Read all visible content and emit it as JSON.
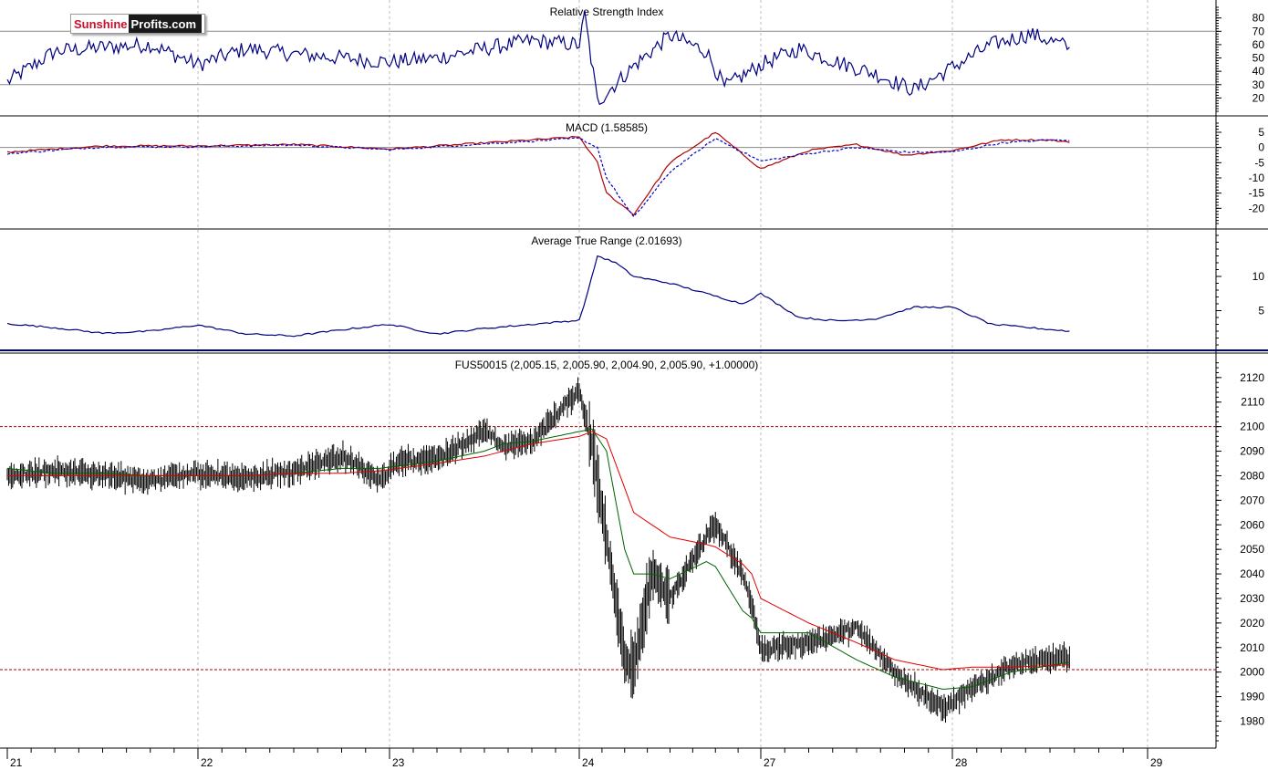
{
  "brand": {
    "part1": "Sunshine",
    "part2": "Profits.com"
  },
  "colors": {
    "price": "#000000",
    "sma_short": "#006400",
    "sma_long": "#e00000",
    "indicator": "#000080",
    "macd": "#b00000",
    "macd_signal": "#0000cc",
    "grid": "#bdbdbd",
    "hline": "#8a8a8a",
    "resistance": "#b00000"
  },
  "x_axis": {
    "ticks": [
      "21",
      "22",
      "23",
      "24",
      "27",
      "28",
      "29"
    ]
  },
  "chart_data": [
    {
      "type": "line",
      "title": "Relative Strength Index",
      "ylim": [
        10,
        88
      ],
      "y_ticks": [
        20,
        30,
        40,
        50,
        60,
        70,
        80
      ],
      "hlines": [
        30,
        70
      ],
      "grid": true,
      "x": [
        0,
        0.25,
        0.5,
        0.75,
        1.0,
        1.25,
        1.5,
        1.75,
        2.0,
        2.25,
        2.5,
        2.75,
        3.0,
        3.03,
        3.1,
        3.3,
        3.5,
        3.7,
        3.8,
        4.0,
        4.2,
        4.4,
        4.6,
        4.8,
        5.0,
        5.2,
        5.4,
        5.6
      ],
      "values": [
        32,
        55,
        58,
        60,
        45,
        57,
        53,
        50,
        47,
        50,
        57,
        63,
        60,
        82,
        17,
        44,
        67,
        55,
        28,
        45,
        57,
        47,
        38,
        26,
        43,
        60,
        68,
        58
      ]
    },
    {
      "type": "line",
      "title": "MACD (1.58585)",
      "ylim": [
        -25,
        8
      ],
      "y_ticks": [
        5,
        0,
        -5,
        -10,
        -15,
        -20
      ],
      "hlines": [
        0
      ],
      "grid": true,
      "x": [
        0,
        0.5,
        1.0,
        1.5,
        2.0,
        2.5,
        3.0,
        3.1,
        3.15,
        3.3,
        3.5,
        3.75,
        4.0,
        4.25,
        4.5,
        4.75,
        5.0,
        5.25,
        5.5,
        5.6
      ],
      "series": [
        {
          "values": [
            -1.5,
            0.5,
            0.5,
            1.0,
            -0.5,
            1.5,
            3.5,
            -5,
            -15,
            -22,
            -5,
            5,
            -7,
            -1,
            1,
            -2.5,
            -1,
            2.5,
            2.5,
            1.6
          ]
        },
        {
          "values": [
            -2.0,
            0.2,
            0.3,
            0.8,
            -0.7,
            1.2,
            3.0,
            0,
            -10,
            -23,
            -8,
            3,
            -4.5,
            -2,
            0,
            -1.5,
            -1.5,
            1.5,
            2.5,
            2.2
          ]
        }
      ]
    },
    {
      "type": "line",
      "title": "Average True Range (2.01693)",
      "ylim": [
        0,
        16
      ],
      "y_ticks": [
        10,
        5
      ],
      "grid": true,
      "x": [
        0,
        0.25,
        0.5,
        0.75,
        1.0,
        1.25,
        1.5,
        1.75,
        2.0,
        2.25,
        2.5,
        2.75,
        3.0,
        3.05,
        3.1,
        3.2,
        3.3,
        3.5,
        3.7,
        3.9,
        4.0,
        4.2,
        4.4,
        4.6,
        4.8,
        5.0,
        5.2,
        5.4,
        5.6
      ],
      "values": [
        3.1,
        2.5,
        1.7,
        2.0,
        2.9,
        1.6,
        1.3,
        2.2,
        3.0,
        1.6,
        2.4,
        3.0,
        3.6,
        8.0,
        13.0,
        12.0,
        10.0,
        9.0,
        7.5,
        6.0,
        7.5,
        4.0,
        3.5,
        3.8,
        5.5,
        5.5,
        3.0,
        2.5,
        2.0
      ]
    },
    {
      "type": "line",
      "title": "FUS50015 (2,005.15, 2,005.90, 2,004.90, 2,005.90, +1.00000)",
      "ylim": [
        1972,
        2127
      ],
      "y_ticks": [
        2120,
        2110,
        2100,
        2090,
        2080,
        2070,
        2060,
        2050,
        2040,
        2030,
        2020,
        2010,
        2000,
        1990,
        1980
      ],
      "hlines": [
        2100,
        2001
      ],
      "grid": true,
      "x": [
        0,
        0.25,
        0.5,
        0.75,
        1.0,
        1.25,
        1.5,
        1.75,
        1.95,
        2.05,
        2.25,
        2.5,
        2.6,
        2.75,
        3.0,
        3.07,
        3.15,
        3.25,
        3.3,
        3.4,
        3.5,
        3.7,
        3.75,
        3.9,
        3.95,
        4.0,
        4.25,
        4.5,
        4.7,
        4.95,
        5.1,
        5.3,
        5.6
      ],
      "series": [
        {
          "values": [
            2080,
            2082,
            2080,
            2078,
            2081,
            2079,
            2082,
            2088,
            2078,
            2086,
            2087,
            2098,
            2092,
            2094,
            2115,
            2092,
            2055,
            2005,
            2001,
            2040,
            2030,
            2055,
            2060,
            2040,
            2028,
            2009,
            2012,
            2018,
            2000,
            1985,
            1993,
            2003,
            2006
          ]
        },
        {
          "values": [
            2083,
            2081,
            2081,
            2080,
            2080,
            2080,
            2081,
            2083,
            2083,
            2084,
            2086,
            2090,
            2093,
            2094,
            2098,
            2099,
            2090,
            2050,
            2040,
            2040,
            2038,
            2045,
            2043,
            2025,
            2022,
            2016,
            2016,
            2005,
            1998,
            1993,
            1994,
            2000,
            2004
          ]
        },
        {
          "values": [
            2080,
            2080,
            2080,
            2080,
            2080,
            2080,
            2081,
            2081,
            2082,
            2083,
            2085,
            2088,
            2090,
            2093,
            2096,
            2098,
            2095,
            2075,
            2065,
            2060,
            2055,
            2052,
            2051,
            2044,
            2040,
            2030,
            2020,
            2012,
            2005,
            2001,
            2002,
            2002,
            2003
          ]
        }
      ]
    }
  ]
}
